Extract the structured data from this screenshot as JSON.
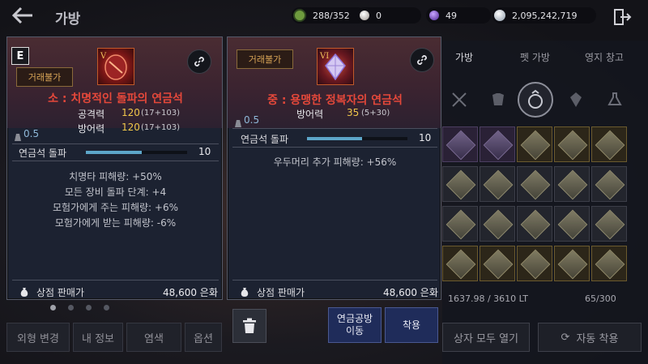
{
  "topbar": {
    "title": "가방",
    "currencies": [
      {
        "icon": "leaf-energy-icon",
        "value": "288/352",
        "color": "#7db04a"
      },
      {
        "icon": "pearl-icon",
        "value": "0",
        "color": "#d9d4cf"
      },
      {
        "icon": "crystal-orb-icon",
        "value": "49",
        "color": "#7b4fd0"
      },
      {
        "icon": "silver-coin-icon",
        "value": "2,095,242,719",
        "color": "#b8c4d0"
      }
    ]
  },
  "inventory": {
    "tabs": [
      "가방",
      "펫 가방",
      "영지 창고"
    ],
    "weight": "1637.98 / 3610 LT",
    "slots": "65/300",
    "open_all_button": "상자 모두 열기",
    "auto_equip_button": "자동 착용"
  },
  "left_menu": {
    "buttons": [
      "외형 변경",
      "내 정보",
      "염색",
      "옵션"
    ]
  },
  "card_left": {
    "grade": "E",
    "trade_tag": "거래불가",
    "name": "소 : 치명적인 돌파의 연금석",
    "stats": [
      {
        "label": "공격력",
        "value": "120",
        "sub": "(17+103)"
      },
      {
        "label": "방어력",
        "value": "120",
        "sub": "(17+103)"
      }
    ],
    "weight": "0.5",
    "breakthrough_label": "연금석 돌파",
    "breakthrough_value": "10",
    "breakthrough_fill": 0.55,
    "effects": [
      "치명타 피해량: +50%",
      "모든 장비 돌파 단계: +4",
      "모험가에게 주는 피해량: +6%",
      "모험가에게 받는 피해량: -6%"
    ],
    "sell_label": "상점 판매가",
    "sell_value": "48,600 은화"
  },
  "card_right": {
    "trade_tag": "거래불가",
    "name": "중 : 용맹한 정복자의 연금석",
    "stats": [
      {
        "label": "방어력",
        "value": "35",
        "sub": "(5+30)"
      }
    ],
    "weight": "0.5",
    "breakthrough_label": "연금석 돌파",
    "breakthrough_value": "10",
    "breakthrough_fill": 0.55,
    "effects": [
      "우두머리 추가 피해량: +56%"
    ],
    "sell_label": "상점 판매가",
    "sell_value": "48,600 은화"
  },
  "actions": {
    "move_label_1": "연금공방",
    "move_label_2": "이동",
    "equip_label": "착용"
  }
}
